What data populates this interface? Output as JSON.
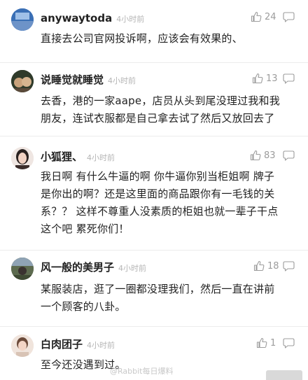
{
  "comments": [
    {
      "user": "anywaytoda",
      "time": "4小时前",
      "likes": "24",
      "text": "直接去公司官网投诉啊，应该会有效果的、"
    },
    {
      "user": "说睡觉就睡觉",
      "time": "4小时前",
      "likes": "13",
      "text": "去香，港的一家aape，店员从头到尾没理过我和我\n朋友，连试衣服都是自己拿去试了然后又放回去了"
    },
    {
      "user": "小狐狸、",
      "time": "4小时前",
      "likes": "83",
      "text": "我日啊  有什么牛逼的啊  你牛逼你别当柜姐啊  牌子\n是你出的啊？还是这里面的商品跟你有一毛钱的关\n系？？  这样不尊重人没素质的柜姐也就一辈子干点\n这个吧  累死你们！"
    },
    {
      "user": "风一般的美男子",
      "time": "4小时前",
      "likes": "18",
      "text": "某服装店，逛了一圈都没理我们，然后一直在讲前\n一个顾客的八卦。"
    },
    {
      "user": "白肉团子",
      "time": "4小时前",
      "likes": "1",
      "text": "至今还没遇到过。"
    }
  ],
  "watermark": "@Rabbit每日爆料",
  "icons": {
    "like": "thumbs-up-icon",
    "reply": "comment-bubble-icon"
  }
}
